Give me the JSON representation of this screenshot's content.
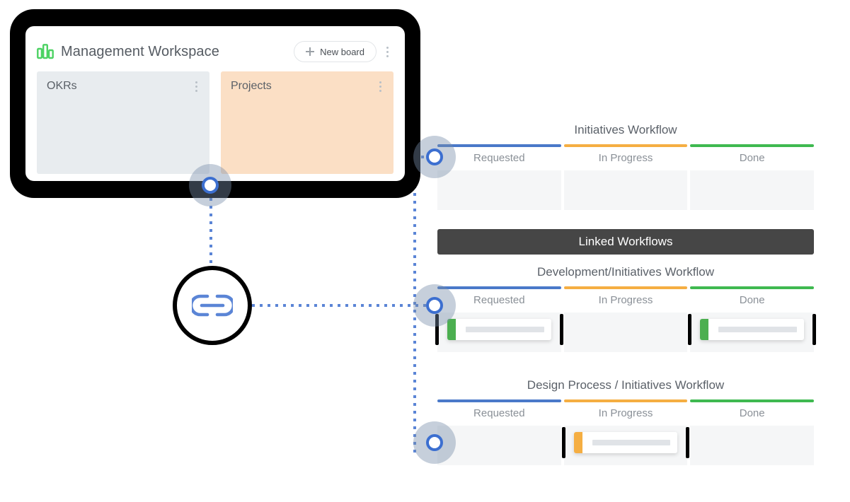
{
  "workspace": {
    "logo_icon": "bar-chart-icon",
    "title": "Management Workspace",
    "new_board_label": "New board",
    "plus_icon": "plus-icon",
    "menu_icon": "kebab-menu-icon",
    "boards": [
      {
        "name": "OKRs",
        "color": "#e8ecef",
        "menu_icon": "kebab-menu-icon"
      },
      {
        "name": "Projects",
        "color": "#fbdfc5",
        "menu_icon": "kebab-menu-icon"
      }
    ]
  },
  "link_badge": {
    "icon": "link-chain-icon",
    "color": "#5b85d6"
  },
  "linked_banner": {
    "label": "Linked Workflows",
    "background": "#464646"
  },
  "columns_meta": {
    "colors": [
      "#4a79c9",
      "#f5ae42",
      "#3fb950"
    ],
    "labels": [
      "Requested",
      "In Progress",
      "Done"
    ]
  },
  "workflows": [
    {
      "title": "Initiatives Workflow",
      "columns": [
        {
          "label": "Requested",
          "bar_color": "#4a79c9",
          "card": null
        },
        {
          "label": "In Progress",
          "bar_color": "#f5ae42",
          "card": null
        },
        {
          "label": "Done",
          "bar_color": "#3fb950",
          "card": null
        }
      ]
    },
    {
      "title": "Development/Initiatives Workflow",
      "columns": [
        {
          "label": "Requested",
          "bar_color": "#4a79c9",
          "card": {
            "accent": "#4caf50",
            "edges": true
          }
        },
        {
          "label": "In Progress",
          "bar_color": "#f5ae42",
          "card": null
        },
        {
          "label": "Done",
          "bar_color": "#3fb950",
          "card": {
            "accent": "#4caf50",
            "edges": true
          }
        }
      ]
    },
    {
      "title": "Design Process / Initiatives Workflow",
      "columns": [
        {
          "label": "Requested",
          "bar_color": "#4a79c9",
          "card": null
        },
        {
          "label": "In Progress",
          "bar_color": "#f5ae42",
          "card": {
            "accent": "#f5ae42",
            "edges": true
          }
        },
        {
          "label": "Done",
          "bar_color": "#3fb950",
          "card": null
        }
      ]
    }
  ],
  "connectors": {
    "node_icon": "connection-node-icon",
    "dot_color": "#5b85d6"
  }
}
